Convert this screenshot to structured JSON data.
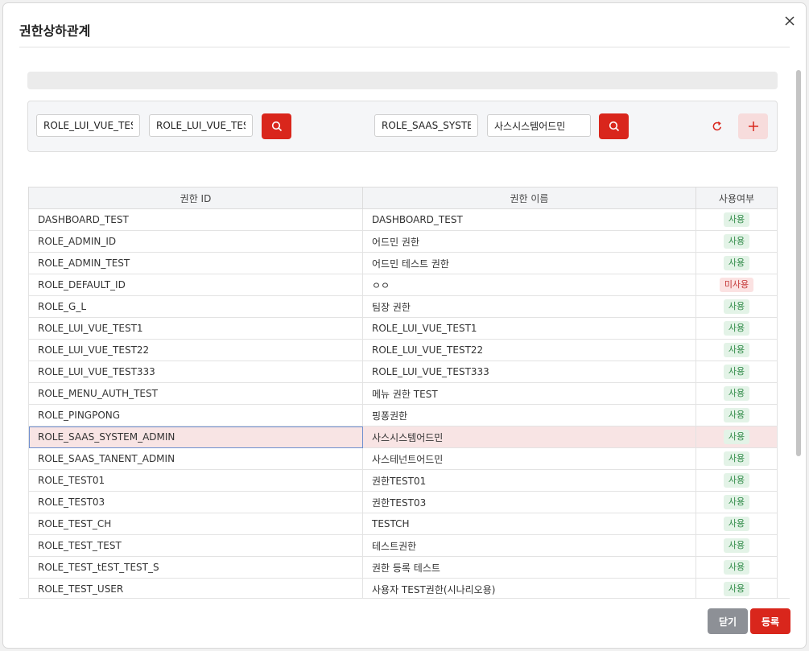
{
  "modal": {
    "title": "권한상하관계"
  },
  "search": {
    "left_id": "ROLE_LUI_VUE_TEST",
    "left_name": "ROLE_LUI_VUE_TEST",
    "right_id": "ROLE_SAAS_SYSTEM",
    "right_name": "사스시스템어드민"
  },
  "table": {
    "headers": [
      "권한 ID",
      "권한 이름",
      "사용여부"
    ],
    "rows": [
      {
        "id": "DASHBOARD_TEST",
        "name": "DASHBOARD_TEST",
        "use": "사용"
      },
      {
        "id": "ROLE_ADMIN_ID",
        "name": "어드민 권한",
        "use": "사용"
      },
      {
        "id": "ROLE_ADMIN_TEST",
        "name": "어드민 테스트 권한",
        "use": "사용"
      },
      {
        "id": "ROLE_DEFAULT_ID",
        "name": "ㅇㅇ",
        "use": "미사용"
      },
      {
        "id": "ROLE_G_L",
        "name": "팀장 권한",
        "use": "사용"
      },
      {
        "id": "ROLE_LUI_VUE_TEST1",
        "name": "ROLE_LUI_VUE_TEST1",
        "use": "사용"
      },
      {
        "id": "ROLE_LUI_VUE_TEST22",
        "name": "ROLE_LUI_VUE_TEST22",
        "use": "사용"
      },
      {
        "id": "ROLE_LUI_VUE_TEST333",
        "name": "ROLE_LUI_VUE_TEST333",
        "use": "사용"
      },
      {
        "id": "ROLE_MENU_AUTH_TEST",
        "name": "메뉴 권한 TEST",
        "use": "사용"
      },
      {
        "id": "ROLE_PINGPONG",
        "name": "핑퐁권한",
        "use": "사용"
      },
      {
        "id": "ROLE_SAAS_SYSTEM_ADMIN",
        "name": "사스시스템어드민",
        "use": "사용",
        "selected": true
      },
      {
        "id": "ROLE_SAAS_TANENT_ADMIN",
        "name": "사스테넌트어드민",
        "use": "사용"
      },
      {
        "id": "ROLE_TEST01",
        "name": "권한TEST01",
        "use": "사용"
      },
      {
        "id": "ROLE_TEST03",
        "name": "권한TEST03",
        "use": "사용"
      },
      {
        "id": "ROLE_TEST_CH",
        "name": "TESTCH",
        "use": "사용"
      },
      {
        "id": "ROLE_TEST_TEST",
        "name": "테스트권한",
        "use": "사용"
      },
      {
        "id": "ROLE_TEST_tEST_TEST_S",
        "name": "권한 등록 테스트",
        "use": "사용"
      },
      {
        "id": "ROLE_TEST_USER",
        "name": "사용자 TEST권한(시나리오용)",
        "use": "사용"
      }
    ]
  },
  "footer": {
    "close_label": "닫기",
    "register_label": "등록"
  },
  "colors": {
    "accent": "#d9261c",
    "active": "#2f8a47",
    "inactive": "#c43a3a",
    "selected_row": "#f8e4e4"
  },
  "icons": {
    "close": "close-icon",
    "search": "search-icon",
    "refresh": "refresh-icon",
    "add": "plus-icon"
  }
}
